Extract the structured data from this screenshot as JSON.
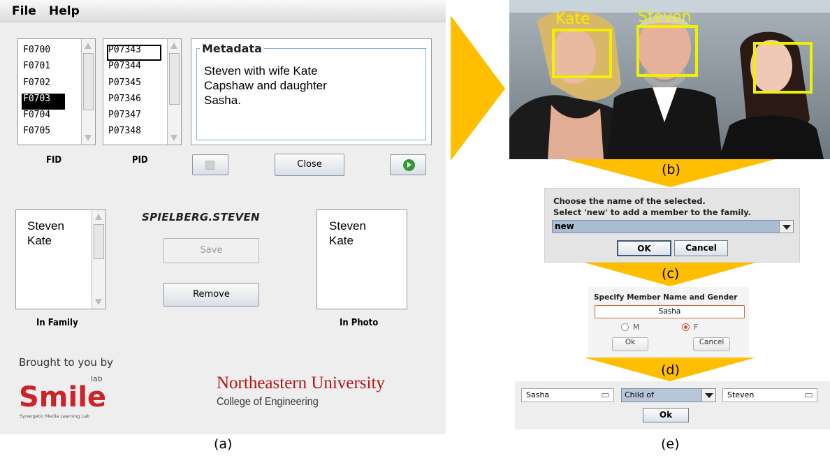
{
  "menu": {
    "file": "File",
    "help": "Help"
  },
  "fid": {
    "items": [
      "F0700",
      "F0701",
      "F0702",
      "F0703",
      "F0704",
      "F0705"
    ],
    "selected": "F0703",
    "caption": "FID"
  },
  "pid": {
    "items": [
      "P07343",
      "P07344",
      "P07345",
      "P07346",
      "P07347",
      "P07348"
    ],
    "selected": "P07343",
    "caption": "PID"
  },
  "metadata": {
    "title": "Metadata",
    "lines": [
      "Steven with wife Kate",
      "Capshaw and daughter",
      "Sasha."
    ]
  },
  "buttons": {
    "close": "Close",
    "save": "Save",
    "remove": "Remove"
  },
  "person_title": "SPIELBERG.STEVEN",
  "in_family": {
    "items": [
      "Steven",
      "Kate"
    ],
    "caption": "In Family"
  },
  "in_photo": {
    "items": [
      "Steven",
      "Kate"
    ],
    "caption": "In Photo"
  },
  "branding": {
    "brought_by": "Brought to you by",
    "smile_logo_text": "Smile",
    "smile_lab": "lab",
    "smile_tagline": "Synergetic Media Learning Lab",
    "university": "Northeastern University",
    "college": "College of Engineering"
  },
  "photo": {
    "tags": [
      "Kate",
      "Steven"
    ]
  },
  "choose_dialog": {
    "line1": "Choose the name of the selected.",
    "line2": "Select 'new' to add a member to the family.",
    "selected": "new",
    "ok": "OK",
    "cancel": "Cancel"
  },
  "member_dialog": {
    "title": "Specify Member Name and Gender",
    "name_value": "Sasha",
    "gender_m": "M",
    "gender_f": "F",
    "gender_selected": "F",
    "ok": "Ok",
    "cancel": "Cancel"
  },
  "relation": {
    "person_a": "Sasha",
    "type": "Child of",
    "person_b": "Steven",
    "ok": "Ok"
  },
  "panel_labels": {
    "a": "(a)",
    "b": "(b)",
    "c": "(c)",
    "d": "(d)",
    "e": "(e)"
  },
  "colors": {
    "arrow": "#ffbf00",
    "face_box": "#f0f000",
    "selection": "#000000",
    "neu_red": "#b5131b",
    "smile_red": "#cc2229"
  },
  "icons": {
    "prev": "left-arrow-icon",
    "next": "right-arrow-circle-icon",
    "dropdown": "chevron-down-icon"
  }
}
